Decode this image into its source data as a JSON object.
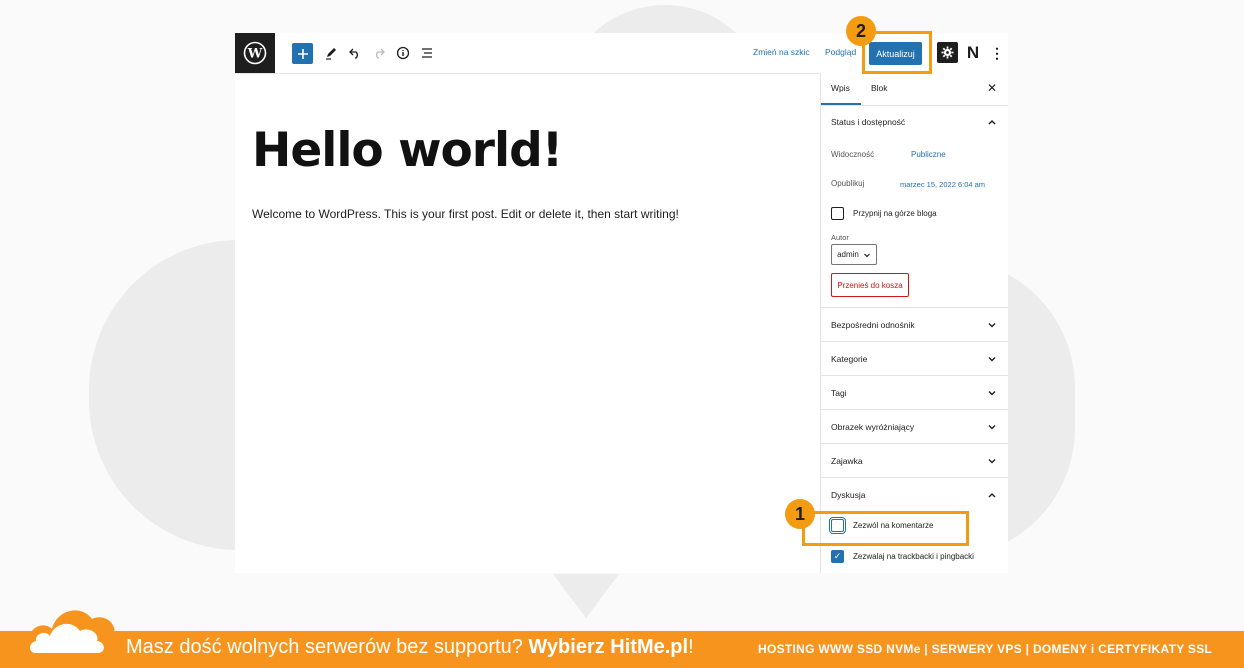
{
  "topbar": {
    "save_draft_label": "Zmień na szkic",
    "preview_label": "Podgląd",
    "update_label": "Aktualizuj",
    "plugin_letter": "N",
    "options_glyph": "⋮"
  },
  "post": {
    "title": "Hello world!",
    "body": "Welcome to WordPress. This is your first post. Edit or delete it, then start writing!"
  },
  "sidebar": {
    "tabs": [
      "Wpis",
      "Blok"
    ],
    "close_glyph": "✕",
    "status": {
      "title": "Status i dostępność",
      "visibility_label": "Widoczność",
      "visibility_value": "Publiczne",
      "publish_label": "Opublikuj",
      "publish_value": "marzec 15, 2022 6:04 am",
      "sticky_label": "Przypnij na górze bloga",
      "author_label": "Autor",
      "author_value": "admin",
      "trash_label": "Przenieś do kosza"
    },
    "sections": [
      "Bezpośredni odnośnik",
      "Kategorie",
      "Tagi",
      "Obrazek wyróżniający",
      "Zajawka"
    ],
    "discussion": {
      "title": "Dyskusja",
      "allow_comments_label": "Zezwól na komentarze",
      "allow_comments_checked": false,
      "allow_pingbacks_label": "Zezwalaj na trackbacki i pingbacki",
      "allow_pingbacks_checked": true
    }
  },
  "callouts": [
    "1",
    "2"
  ],
  "footer": {
    "text_regular": "Masz dość wolnych serwerów bez supportu? ",
    "text_bold": "Wybierz HitMe.pl",
    "text_end": "!",
    "services": "HOSTING WWW SSD NVMe | SERWERY VPS | DOMENY i CERTYFIKATY SSL"
  },
  "colors": {
    "accent": "#2271b1",
    "callout": "#f39c12",
    "banner": "#f7941d",
    "danger": "#cc1818"
  },
  "icons": [
    "wordpress-logo-icon",
    "plus-icon",
    "pencil-icon",
    "undo-icon",
    "redo-icon",
    "info-icon",
    "list-view-icon",
    "gear-icon",
    "chevron-up-icon",
    "chevron-down-icon",
    "check-icon",
    "cloud-logo-icon"
  ]
}
